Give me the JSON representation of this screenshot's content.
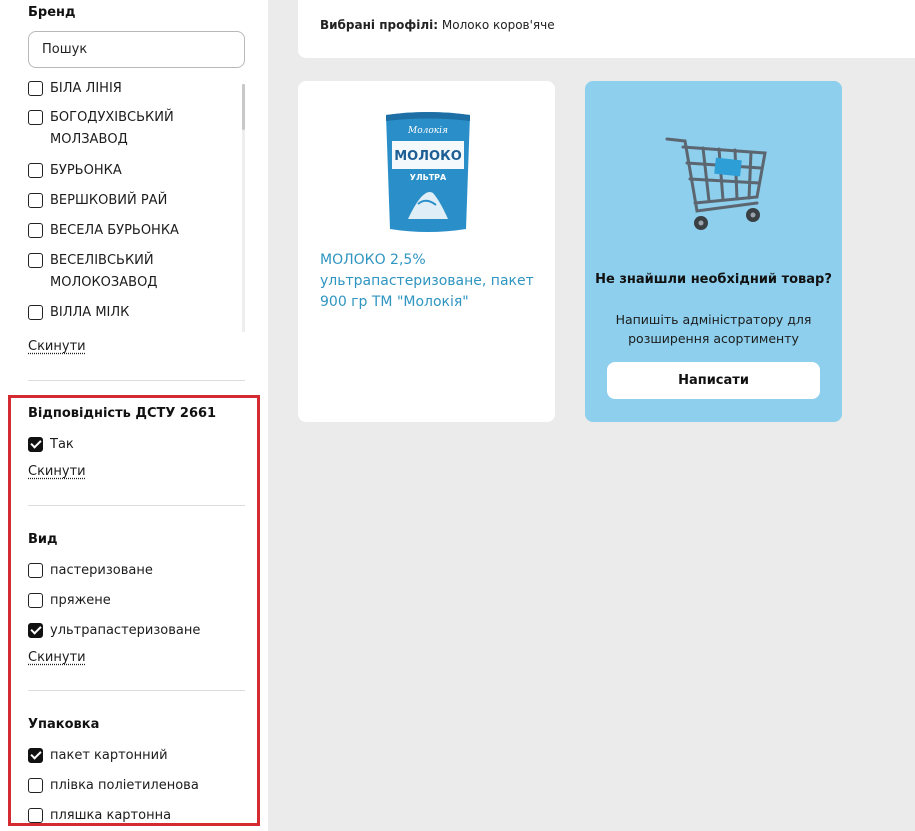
{
  "sidebar": {
    "brand": {
      "title": "Бренд",
      "search_placeholder": "Пошук",
      "items": [
        {
          "label": "БІЛА ЛІНІЯ",
          "checked": false
        },
        {
          "label": "БОГОДУХІВСЬКИЙ МОЛЗАВОД",
          "checked": false
        },
        {
          "label": "БУРЬОНКА",
          "checked": false
        },
        {
          "label": "ВЕРШКОВИЙ РАЙ",
          "checked": false
        },
        {
          "label": "ВЕСЕЛА БУРЬОНКА",
          "checked": false
        },
        {
          "label": "ВЕСЕЛІВСЬКИЙ МОЛОКОЗАВОД",
          "checked": false
        },
        {
          "label": "ВІЛЛА МІЛК",
          "checked": false
        }
      ],
      "reset": "Скинути"
    },
    "dstu": {
      "title": "Відповідність ДСТУ 2661",
      "items": [
        {
          "label": "Так",
          "checked": true
        }
      ],
      "reset": "Скинути"
    },
    "kind": {
      "title": "Вид",
      "items": [
        {
          "label": "пастеризоване",
          "checked": false
        },
        {
          "label": "пряжене",
          "checked": false
        },
        {
          "label": "ультрапастеризоване",
          "checked": true
        }
      ],
      "reset": "Скинути"
    },
    "packaging": {
      "title": "Упаковка",
      "items": [
        {
          "label": "пакет картонний",
          "checked": true
        },
        {
          "label": "плівка поліетиленова",
          "checked": false
        },
        {
          "label": "пляшка картонна",
          "checked": false
        }
      ]
    }
  },
  "topbar": {
    "profiles_label": "Вибрані профілі:",
    "profiles_value": " Молоко коров'яче"
  },
  "product": {
    "title": "МОЛОКО 2,5% ультрапастеризоване, пакет 900 гр ТМ \"Молокія\"",
    "pack_brand": "Молокія",
    "pack_name": "МОЛОКО",
    "pack_type": "УЛЬТРА"
  },
  "promo": {
    "title": "Не знайшли необхідний товар?",
    "text": "Напишіть адміністратору для розширення асортименту",
    "button": "Написати"
  },
  "colors": {
    "highlight": "#d42a32",
    "link": "#2f95c1",
    "promo_bg": "#8dcfec"
  }
}
